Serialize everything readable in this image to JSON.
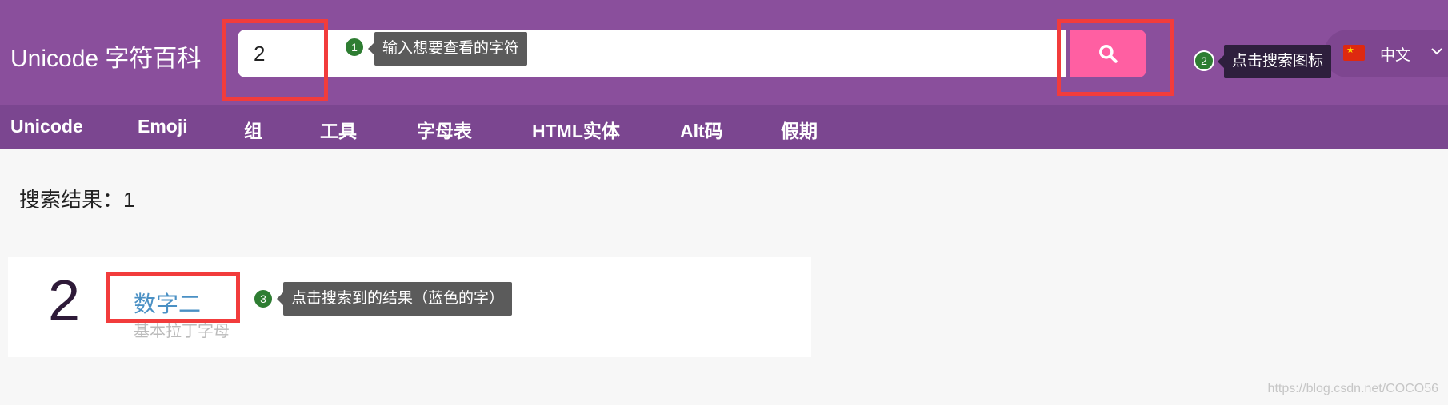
{
  "header": {
    "logo": "Unicode 字符百科",
    "search": {
      "value": "2",
      "placeholder": ""
    },
    "search_button_icon": "search-icon",
    "lang": {
      "flag_icon": "china-flag-icon",
      "label": "中文",
      "chevron_icon": "chevron-down-icon"
    }
  },
  "nav": {
    "items": [
      "Unicode",
      "Emoji",
      "组",
      "工具",
      "字母表",
      "HTML实体",
      "Alt码",
      "假期"
    ]
  },
  "results": {
    "label": "搜索结果",
    "colon": "：",
    "count": "1",
    "items": [
      {
        "glyph": "2",
        "name": "数字二",
        "category": "基本拉丁字母"
      }
    ]
  },
  "annotations": [
    {
      "number": "1",
      "text": "输入想要查看的字符"
    },
    {
      "number": "2",
      "text": "点击搜索图标"
    },
    {
      "number": "3",
      "text": "点击搜索到的结果（蓝色的字）"
    }
  ],
  "watermark": "https://blog.csdn.net/COCO56",
  "colors": {
    "header_bg": "#8a4f9c",
    "nav_bg": "#7b4690",
    "search_button": "#ff5fa2",
    "highlight": "#f23c3c",
    "badge": "#2e7d32",
    "link": "#4a90c4"
  }
}
